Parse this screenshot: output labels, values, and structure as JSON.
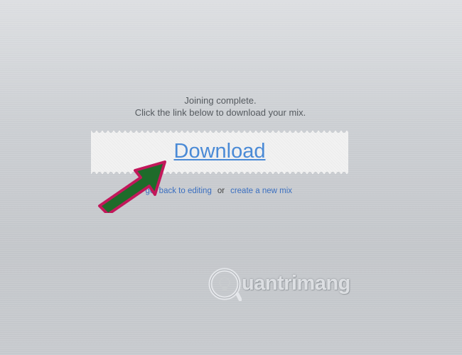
{
  "message": {
    "line1": "Joining complete.",
    "line2": "Click the link below to download your mix."
  },
  "download": {
    "label": "Download"
  },
  "links": {
    "back_arrow": "←",
    "back_label": "get back to editing",
    "separator": "or",
    "new_mix_label": "create a new mix"
  },
  "watermark": {
    "text": "uantrimang"
  },
  "colors": {
    "link": "#4a8ad6",
    "annotation_arrow_fill": "#1e6b2a",
    "annotation_arrow_border": "#c2185b"
  }
}
